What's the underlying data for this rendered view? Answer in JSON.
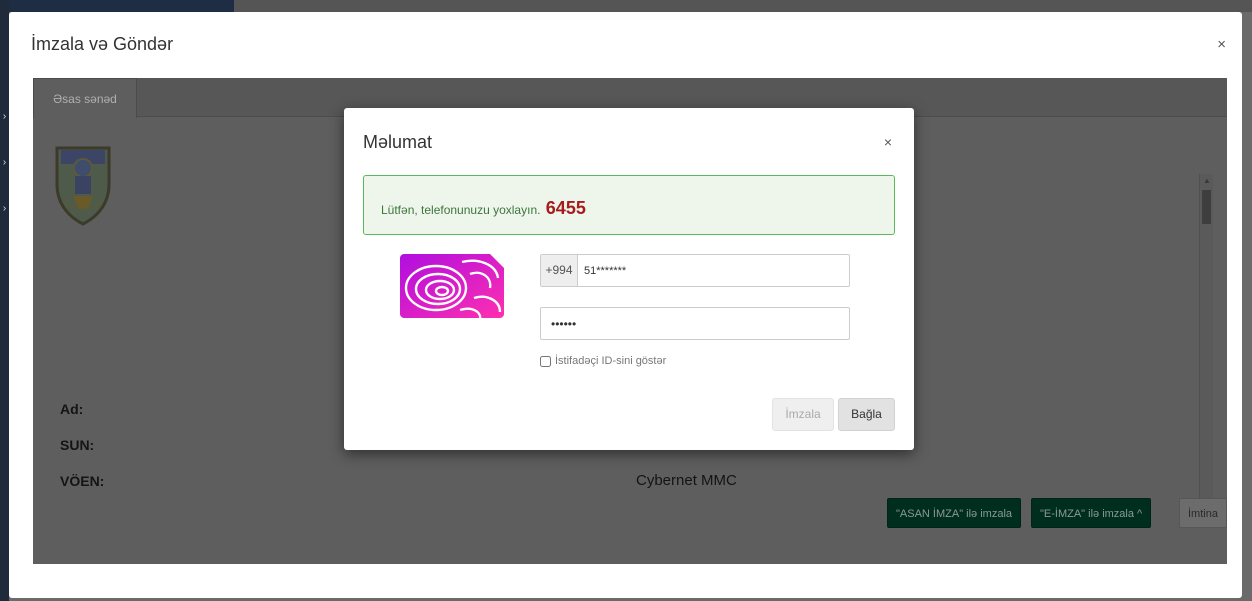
{
  "outer_modal": {
    "title": "İmzala və Göndər",
    "close_label": "×",
    "tabs": [
      {
        "label": "Əsas sənəd"
      }
    ],
    "fields": [
      {
        "label": "Ad:",
        "value": ""
      },
      {
        "label": "SUN:",
        "value": ""
      },
      {
        "label": "VÖEN:",
        "value": "Cybernet MMC"
      }
    ],
    "actions": {
      "asan_label": "\"ASAN İMZA\" ilə imzala",
      "eimza_label": "\"E-İMZA\" ilə imzala ^",
      "cancel_label": "İmtina"
    }
  },
  "inner_modal": {
    "title": "Məlumat",
    "close_label": "×",
    "alert": {
      "text": "Lütfən, telefonunuzu yoxlayın.",
      "code": "6455",
      "color": "#a61c1c"
    },
    "phone": {
      "prefix": "+994",
      "value": "51*******"
    },
    "pin": {
      "value": "••••••"
    },
    "show_id_label": "İstifadəçi ID-sini göstər",
    "show_id_checked": false,
    "sign_button_label": "İmzala",
    "close_button_label": "Bağla"
  },
  "colors": {
    "accent_green": "#00543a",
    "alert_border": "#5cb85c",
    "alert_bg": "#eef6ec",
    "sim_gradient_start": "#b00ee0",
    "sim_gradient_end": "#ff2fb0"
  },
  "icons": {
    "sim": "asan-imza-sim-icon",
    "emblem": "tax-ministry-emblem-icon"
  }
}
